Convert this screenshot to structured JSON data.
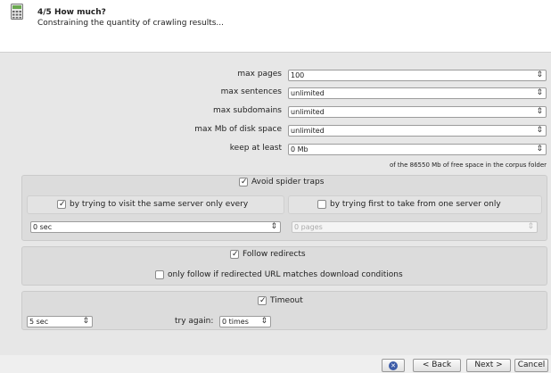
{
  "header": {
    "title": "4/5 How much?",
    "subtitle": "Constraining the quantity of crawling results..."
  },
  "limits": {
    "max_pages_label": "max pages",
    "max_pages_value": "100",
    "max_sentences_label": "max sentences",
    "max_sentences_value": "unlimited",
    "max_subdomains_label": "max subdomains",
    "max_subdomains_value": "unlimited",
    "max_mb_label": "max Mb of disk space",
    "max_mb_value": "unlimited",
    "keep_at_least_label": "keep at least",
    "keep_at_least_value": "0 Mb",
    "free_space_note": "of the 86550 Mb of free space in the corpus folder"
  },
  "spider_traps": {
    "label": "Avoid spider traps",
    "checked": true,
    "same_server_label": "by trying to visit the same server only every",
    "same_server_checked": true,
    "same_server_value": "0 sec",
    "one_server_label": "by trying first to take from one server only",
    "one_server_checked": false,
    "one_server_value": "0 pages"
  },
  "redirects": {
    "label": "Follow redirects",
    "checked": true,
    "match_label": "only follow if redirected URL matches download conditions",
    "match_checked": false
  },
  "timeout": {
    "label": "Timeout",
    "checked": true,
    "value": "5 sec",
    "try_again_label": "try again:",
    "try_again_value": "0 times"
  },
  "footer": {
    "help_icon": "help-icon",
    "back_label": "< Back",
    "next_label": "Next >",
    "cancel_label": "Cancel"
  },
  "colors": {
    "header_bg": "#ffffff",
    "panel_bg": "#e7e7e7",
    "group_bg": "#dcdcdc",
    "help_blue": "#3c5ba8"
  }
}
